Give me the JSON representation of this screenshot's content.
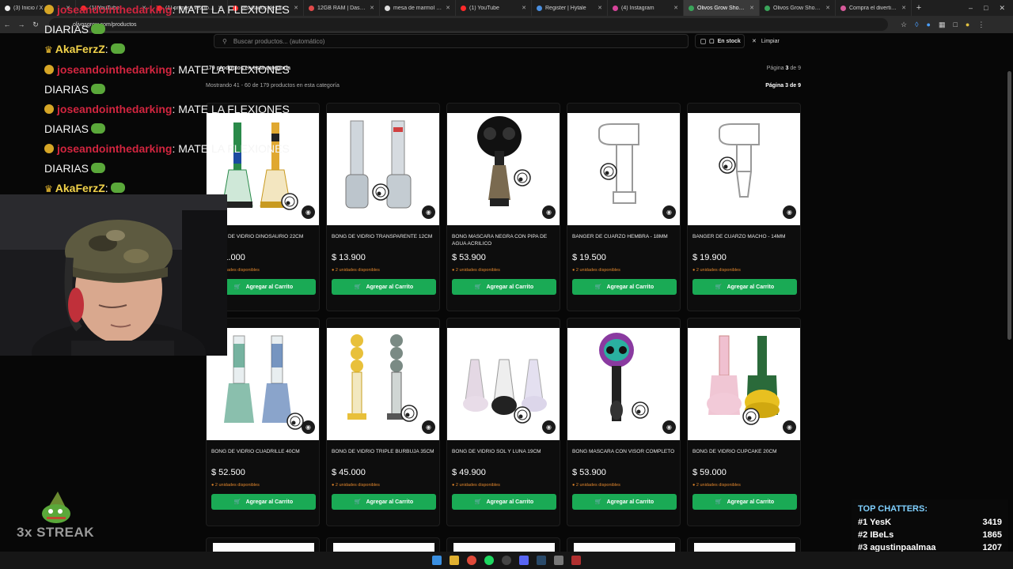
{
  "browser": {
    "tabs": [
      {
        "title": "(3) Inicio / X",
        "color": "#eeeeee"
      },
      {
        "title": "(1) YouTube",
        "color": "#ff2a2a"
      },
      {
        "title": "(1) primera vez tom...",
        "color": "#ff2a2a"
      },
      {
        "title": "resultados de cluster o...",
        "color": "#ff2a2a"
      },
      {
        "title": "12GB RAM | Dashboa...",
        "color": "#e04a4a"
      },
      {
        "title": "mesa de marmol vinil...",
        "color": "#dddddd"
      },
      {
        "title": "(1) YouTube",
        "color": "#ff2a2a"
      },
      {
        "title": "Register | Hytale",
        "color": "#4a8fe0"
      },
      {
        "title": "(4) Instagram",
        "color": "#d6449a"
      },
      {
        "title": "Olivos Grow Shop - T...",
        "color": "#3aa55a",
        "active": true
      },
      {
        "title": "Olivos Grow Shop - T...",
        "color": "#3aa55a"
      },
      {
        "title": "Compra el divertido B...",
        "color": "#d65a9a"
      }
    ],
    "url": "olivosgrow.com/productos"
  },
  "shop": {
    "search_placeholder": "Buscar productos... (automático)",
    "stock_label": "En stock",
    "clear_label": "Limpiar",
    "count_text": "179 productos en esta categoría",
    "showing_text": "Mostrando 41 - 60 de 179 productos en esta categoría",
    "page_prefix": "Página",
    "page_current": "3",
    "page_of": "de",
    "page_total": "9",
    "add_label": "Agregar al Carrito",
    "products": [
      {
        "name": "BONG DE VIDRIO DINOSAURIO 22CM",
        "price": "$ 51.000",
        "avail": "2 unidades disponibles",
        "img": "dino"
      },
      {
        "name": "BONG DE VIDRIO TRANSPARENTE 12CM",
        "price": "$ 13.900",
        "avail": "2 unidades disponibles",
        "img": "clear"
      },
      {
        "name": "BONG MASCARA NEGRA CON PIPA DE AGUA ACRILICO",
        "price": "$ 53.900",
        "avail": "2 unidades disponibles",
        "img": "mask"
      },
      {
        "name": "BANGER DE CUARZO HEMBRA - 18MM",
        "price": "$ 19.500",
        "avail": "2 unidades disponibles",
        "img": "banger"
      },
      {
        "name": "BANGER DE CUARZO MACHO - 14MM",
        "price": "$ 19.900",
        "avail": "2 unidades disponibles",
        "img": "banger2"
      },
      {
        "name": "BONG DE VIDRIO CUADRILLE 40CM",
        "price": "$ 52.500",
        "avail": "2 unidades disponibles",
        "img": "plaid"
      },
      {
        "name": "BONG DE VIDRIO TRIPLE BURBUJA 35CM",
        "price": "$ 45.000",
        "avail": "2 unidades disponibles",
        "img": "bubble"
      },
      {
        "name": "BONG DE VIDRIO SOL Y LUNA 19CM",
        "price": "$ 49.900",
        "avail": "2 unidades disponibles",
        "img": "sunmoon"
      },
      {
        "name": "BONG MASCARA CON VISOR COMPLETO",
        "price": "$ 53.900",
        "avail": "2 unidades disponibles",
        "img": "skull"
      },
      {
        "name": "BONG DE VIDRIO CUPCAKE 20CM",
        "price": "$ 59.000",
        "avail": "2 unidades disponibles",
        "img": "cupcake"
      }
    ]
  },
  "stream": {
    "chat": [
      {
        "user": "joseandointhedarking",
        "msg": ": MATE LA FLEXIONES",
        "type": "jose"
      },
      {
        "user": "",
        "msg": "DIARIAS",
        "type": "cont"
      },
      {
        "user": "AkaFerzZ",
        "msg": ":",
        "type": "aka"
      },
      {
        "user": "joseandointhedarking",
        "msg": ": MATE LA FLEXIONES",
        "type": "jose"
      },
      {
        "user": "",
        "msg": "DIARIAS",
        "type": "cont"
      },
      {
        "user": "joseandointhedarking",
        "msg": ": MATE LA FLEXIONES",
        "type": "jose"
      },
      {
        "user": "",
        "msg": "DIARIAS",
        "type": "cont"
      },
      {
        "user": "joseandointhedarking",
        "msg": ": MATE LA FLEXIONES",
        "type": "jose"
      },
      {
        "user": "",
        "msg": "DIARIAS",
        "type": "cont"
      },
      {
        "user": "AkaFerzZ",
        "msg": ":",
        "type": "aka"
      }
    ],
    "streak_text": "3x STREAK",
    "top_chatters_title": "TOP CHATTERS:",
    "top_chatters": [
      {
        "rank": "#1",
        "name": "YesK",
        "count": "3419"
      },
      {
        "rank": "#2",
        "name": "IBeLs",
        "count": "1865"
      },
      {
        "rank": "#3",
        "name": "agustinpaalmaa",
        "count": "1207"
      }
    ]
  }
}
